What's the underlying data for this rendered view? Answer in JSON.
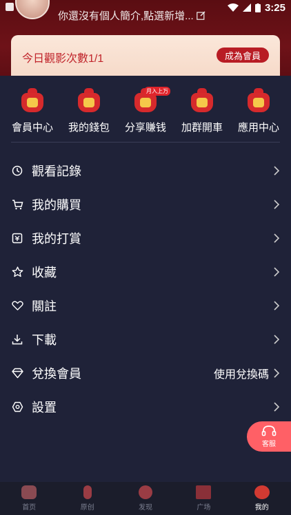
{
  "status_bar": {
    "time": "3:25"
  },
  "profile": {
    "bio": "你還沒有個人簡介,點選新增..."
  },
  "vip": {
    "count_text": "今日觀影次數1/1",
    "button_label": "成為會員"
  },
  "grid": [
    {
      "label": "會員中心",
      "icon": "crown-bag-icon"
    },
    {
      "label": "我的錢包",
      "icon": "wallet-bag-icon"
    },
    {
      "label": "分享賺钱",
      "icon": "share-bag-icon",
      "badge": "月入上万"
    },
    {
      "label": "加群開車",
      "icon": "car-bag-icon"
    },
    {
      "label": "應用中心",
      "icon": "app-bag-icon"
    }
  ],
  "menu": [
    {
      "label": "觀看記錄",
      "icon": "clock-icon"
    },
    {
      "label": "我的購買",
      "icon": "cart-icon"
    },
    {
      "label": "我的打賞",
      "icon": "reward-icon"
    },
    {
      "label": "收藏",
      "icon": "star-icon"
    },
    {
      "label": "關註",
      "icon": "heart-icon"
    },
    {
      "label": "下載",
      "icon": "download-icon"
    },
    {
      "label": "兌換會員",
      "icon": "diamond-icon",
      "extra": "使用兌換碼"
    },
    {
      "label": "設置",
      "icon": "settings-icon"
    }
  ],
  "customer_service": {
    "label": "客服"
  },
  "tabs": [
    {
      "label": "首页",
      "color": "#8a4a52"
    },
    {
      "label": "原创",
      "color": "#9a3c44"
    },
    {
      "label": "发现",
      "color": "#9a3c44"
    },
    {
      "label": "广场",
      "color": "#8a3038"
    },
    {
      "label": "我的",
      "color": "#d23a32",
      "active": true
    }
  ]
}
